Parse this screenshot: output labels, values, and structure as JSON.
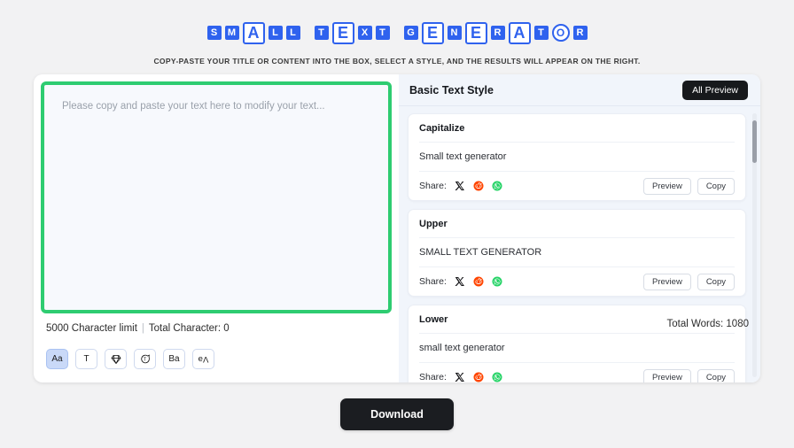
{
  "header": {
    "title_tiles": [
      {
        "ch": "S",
        "style": "small"
      },
      {
        "ch": "M",
        "style": "small"
      },
      {
        "ch": "A",
        "style": "big"
      },
      {
        "ch": "L",
        "style": "small"
      },
      {
        "ch": "L",
        "style": "small"
      },
      {
        "ch": "gap",
        "style": "gap"
      },
      {
        "ch": "T",
        "style": "small"
      },
      {
        "ch": "E",
        "style": "big"
      },
      {
        "ch": "X",
        "style": "small"
      },
      {
        "ch": "T",
        "style": "small"
      },
      {
        "ch": "gap",
        "style": "gap"
      },
      {
        "ch": "G",
        "style": "small"
      },
      {
        "ch": "E",
        "style": "big"
      },
      {
        "ch": "N",
        "style": "small"
      },
      {
        "ch": "E",
        "style": "big"
      },
      {
        "ch": "R",
        "style": "small"
      },
      {
        "ch": "A",
        "style": "big"
      },
      {
        "ch": "T",
        "style": "small"
      },
      {
        "ch": "O",
        "style": "circle"
      },
      {
        "ch": "R",
        "style": "small"
      }
    ],
    "title_plain": "SMALL TEXT GENERATOR",
    "subtitle": "COPY-PASTE YOUR TITLE OR CONTENT INTO THE BOX, SELECT A STYLE, AND THE RESULTS WILL APPEAR ON THE RIGHT.",
    "accent_blue": "#2f62ee"
  },
  "editor": {
    "placeholder": "Please copy and paste your text here to modify your text...",
    "value": "",
    "border_color": "#2ecc71",
    "char_limit_text": "5000 Character limit",
    "separator": "|",
    "total_character_text": "Total Character: 0",
    "total_words_text": "Total Words: 1080",
    "toolbar": [
      {
        "name": "font-style-icon",
        "label": "Aa",
        "active": true
      },
      {
        "name": "text-icon",
        "label": "T",
        "active": false
      },
      {
        "name": "diamond-icon",
        "label": "",
        "active": false
      },
      {
        "name": "bubble-text-icon",
        "label": "",
        "active": false
      },
      {
        "name": "bold-icon",
        "label": "Ba",
        "active": false
      },
      {
        "name": "flip-text-icon",
        "label": "ev",
        "active": false
      }
    ]
  },
  "preview": {
    "title": "Basic Text Style",
    "all_preview_label": "All Preview",
    "share_label": "Share:",
    "share_icons": [
      {
        "name": "x-twitter-icon",
        "color": "#18181b"
      },
      {
        "name": "reddit-icon",
        "color": "#ff4500"
      },
      {
        "name": "whatsapp-icon",
        "color": "#25d366"
      }
    ],
    "preview_button_label": "Preview",
    "copy_button_label": "Copy",
    "cards": [
      {
        "label": "Capitalize",
        "sample": "Small text generator"
      },
      {
        "label": "Upper",
        "sample": "SMALL TEXT GENERATOR"
      },
      {
        "label": "Lower",
        "sample": "small text generator"
      }
    ]
  },
  "footer": {
    "download_label": "Download"
  }
}
